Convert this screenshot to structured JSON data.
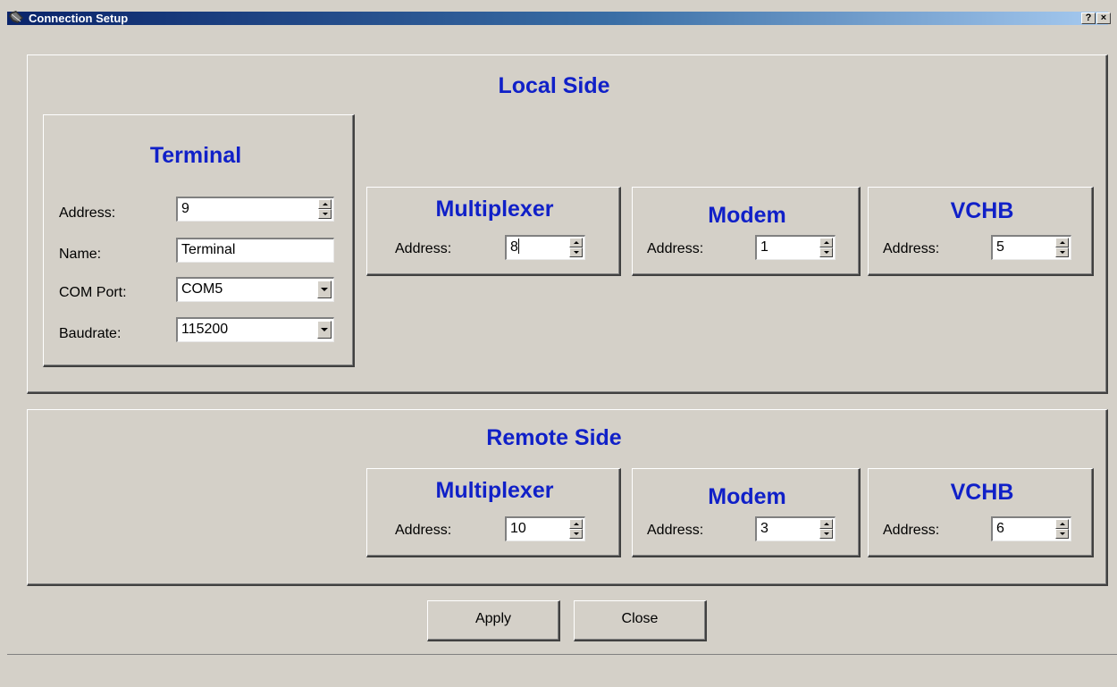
{
  "window": {
    "title": "Connection Setup",
    "help_button": "?",
    "close_button": "×"
  },
  "local": {
    "title": "Local Side",
    "terminal": {
      "title": "Terminal",
      "address_label": "Address:",
      "address_value": "9",
      "name_label": "Name:",
      "name_value": "Terminal",
      "com_label": "COM Port:",
      "com_value": "COM5",
      "baud_label": "Baudrate:",
      "baud_value": "115200"
    },
    "multiplexer": {
      "title": "Multiplexer",
      "address_label": "Address:",
      "address_value": "8"
    },
    "modem": {
      "title": "Modem",
      "address_label": "Address:",
      "address_value": "1"
    },
    "vchb": {
      "title": "VCHB",
      "address_label": "Address:",
      "address_value": "5"
    }
  },
  "remote": {
    "title": "Remote Side",
    "multiplexer": {
      "title": "Multiplexer",
      "address_label": "Address:",
      "address_value": "10"
    },
    "modem": {
      "title": "Modem",
      "address_label": "Address:",
      "address_value": "3"
    },
    "vchb": {
      "title": "VCHB",
      "address_label": "Address:",
      "address_value": "6"
    }
  },
  "buttons": {
    "apply": "Apply",
    "close": "Close"
  }
}
